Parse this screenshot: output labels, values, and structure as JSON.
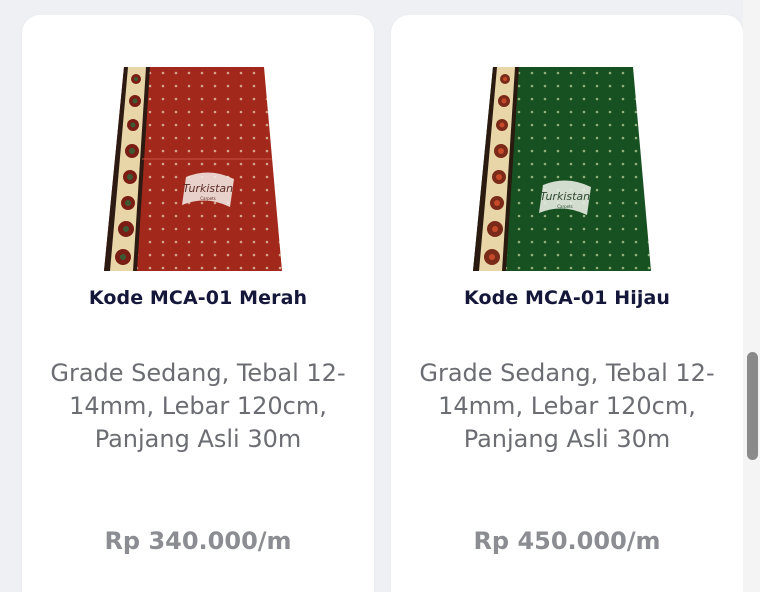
{
  "products": [
    {
      "code": "Kode MCA-01 Merah",
      "description": "Grade Sedang, Tebal 12-14mm, Lebar 120cm, Panjang Asli 30m",
      "price": "Rp 340.000/m",
      "image": {
        "color": "#a2281c",
        "dot_color": "#d4a48a",
        "logo_text": "Turkistan",
        "logo_sub": "Carpets",
        "icon": "carpet-image"
      }
    },
    {
      "code": "Kode MCA-01 Hijau",
      "description": "Grade Sedang, Tebal 12-14mm, Lebar 120cm, Panjang Asli 30m",
      "price": "Rp 450.000/m",
      "image": {
        "color": "#185121",
        "dot_color": "#8fb07a",
        "logo_text": "Turkistan",
        "logo_sub": "Carpets",
        "icon": "carpet-image"
      }
    }
  ]
}
